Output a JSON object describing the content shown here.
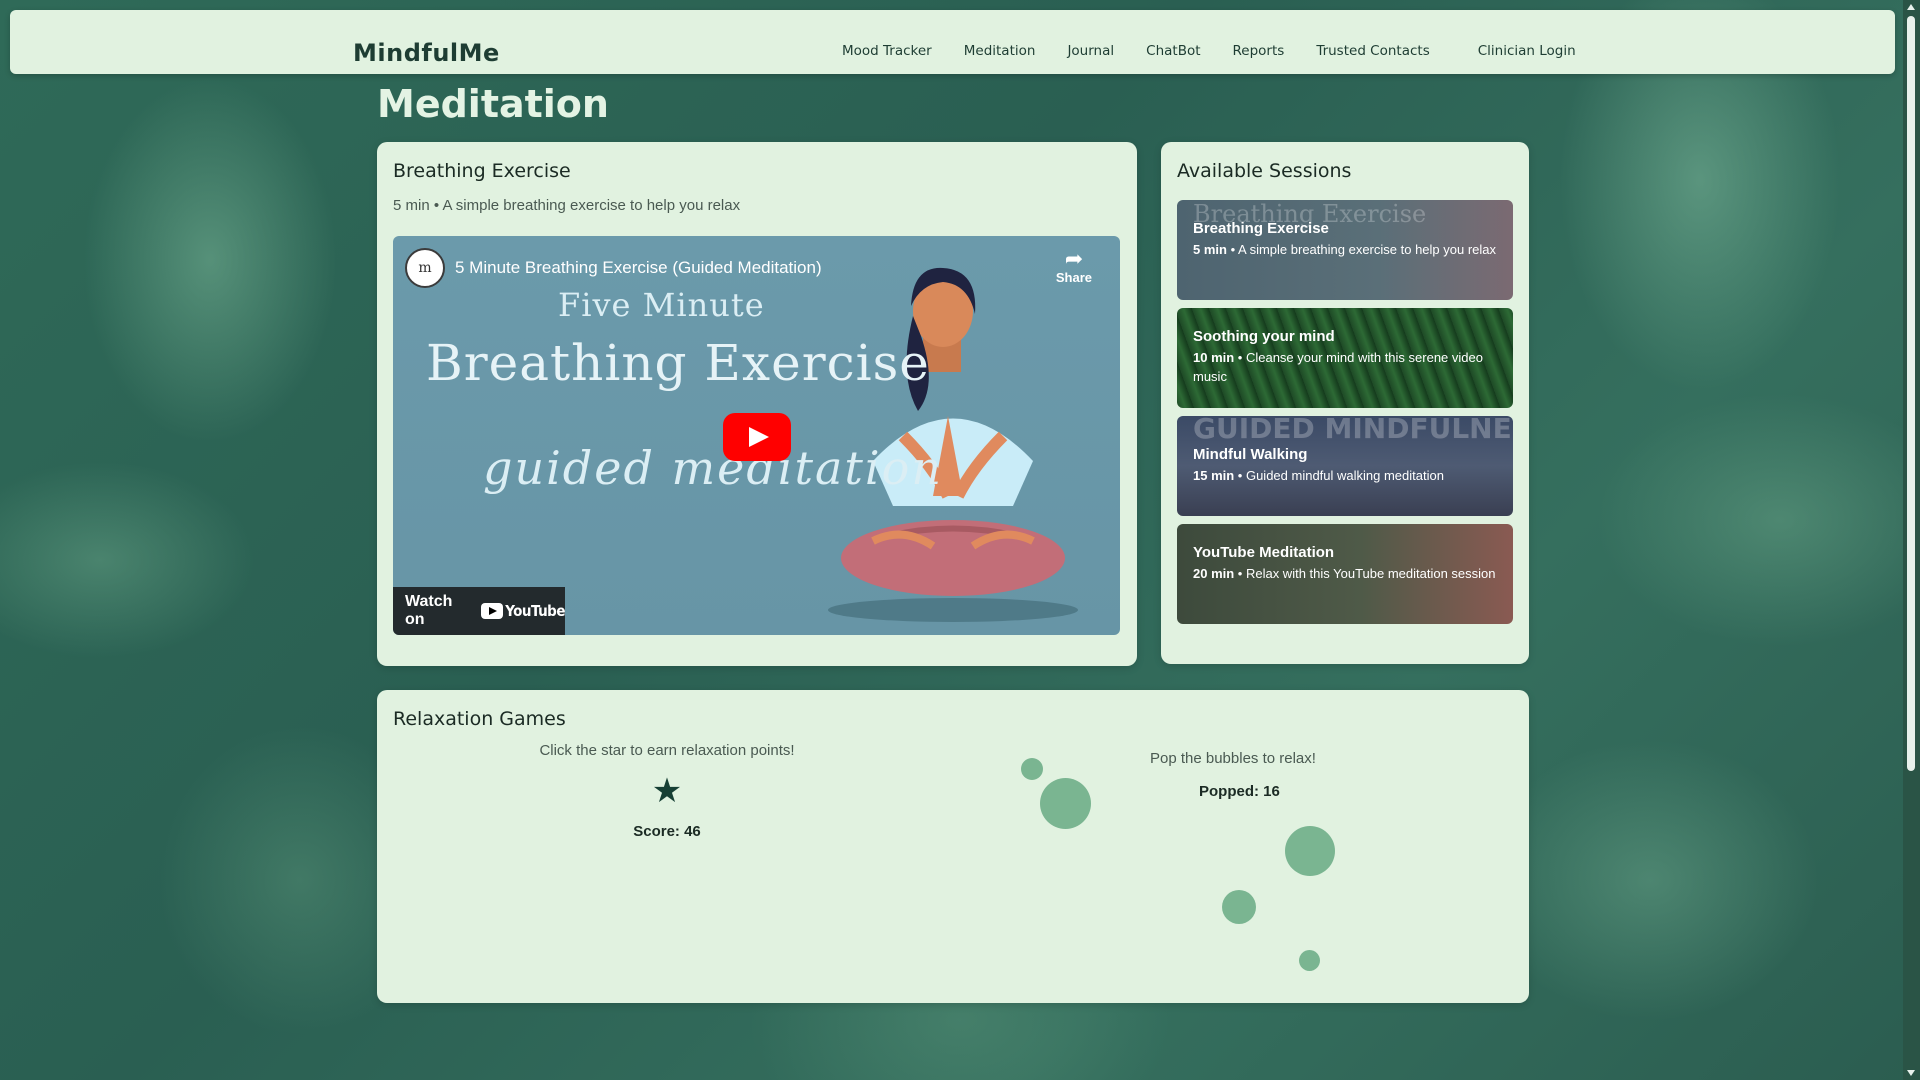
{
  "nav": {
    "brand": "MindfulMe",
    "links": [
      "Mood Tracker",
      "Meditation",
      "Journal",
      "ChatBot",
      "Reports",
      "Trusted Contacts"
    ],
    "clinician": "Clinician Login"
  },
  "page": {
    "title": "Meditation"
  },
  "player": {
    "title": "Breathing Exercise",
    "subtitle": "5 min • A simple breathing exercise to help you relax",
    "video": {
      "title": "5 Minute Breathing Exercise (Guided Meditation)",
      "channel_logo": "m",
      "share_label": "Share",
      "line1": "Five Minute",
      "line2": "Breathing Exercise",
      "line3": "guided  meditation",
      "watch_on": "Watch on",
      "platform": "YouTube"
    }
  },
  "sessions": {
    "title": "Available Sessions",
    "items": [
      {
        "title": "Breathing Exercise",
        "duration": "5 min",
        "desc": " • A simple breathing exercise to help you relax",
        "bg_text": "Breathing Exercise"
      },
      {
        "title": "Soothing your mind",
        "duration": "10 min",
        "desc": " • Cleanse your mind with this serene video music",
        "bg_text": ""
      },
      {
        "title": "Mindful Walking",
        "duration": "15 min",
        "desc": " • Guided mindful walking meditation",
        "bg_text": "GUIDED MINDFULNESS"
      },
      {
        "title": "YouTube Meditation",
        "duration": "20 min",
        "desc": " • Relax with this YouTube meditation session",
        "bg_text": ""
      }
    ]
  },
  "games": {
    "title": "Relaxation Games",
    "star_instruction": "Click the star to earn relaxation points!",
    "star_icon": "★",
    "score_label": "Score: 46",
    "bubble_instruction": "Pop the bubbles to relax!",
    "popped_label": "Popped: 16"
  },
  "colors": {
    "accent": "#163f34",
    "card_bg": "#e1f2e0",
    "bubble": "#6fae88",
    "youtube_red": "#ff0000"
  }
}
